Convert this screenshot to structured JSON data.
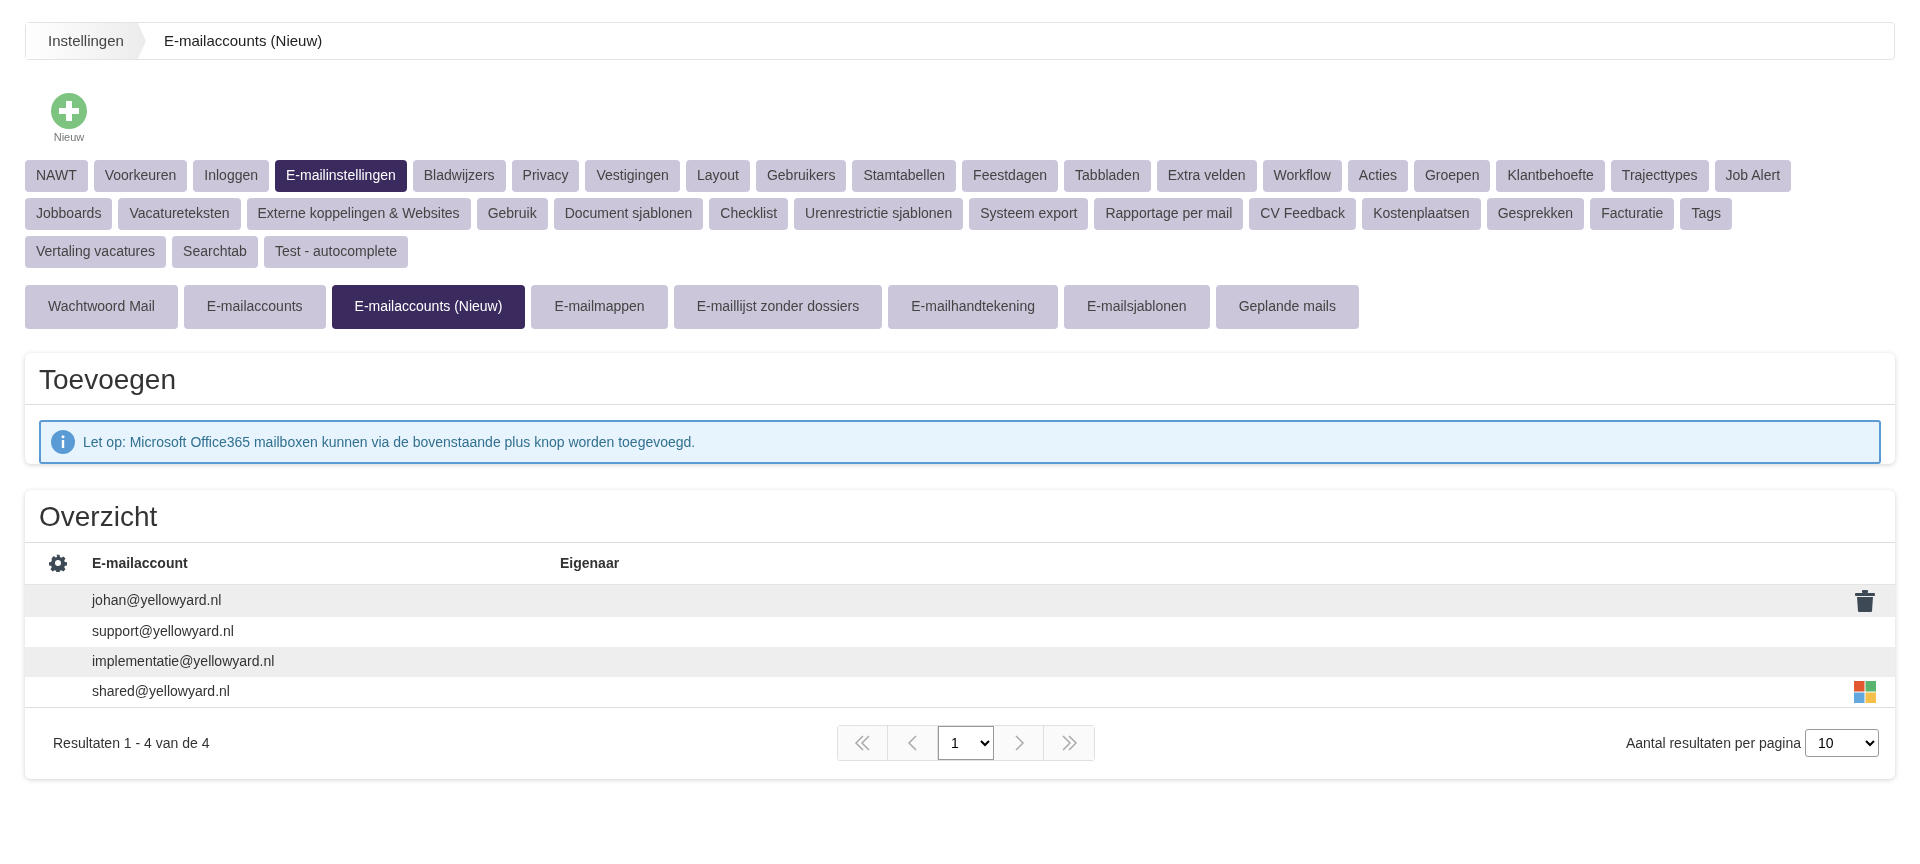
{
  "breadcrumb": [
    {
      "label": "Instellingen"
    },
    {
      "label": "E-mailaccounts (Nieuw)"
    }
  ],
  "new_button": {
    "label": "Nieuw"
  },
  "tab_rows": [
    [
      {
        "label": "NAWT",
        "selected": false
      },
      {
        "label": "Voorkeuren",
        "selected": false
      },
      {
        "label": "Inloggen",
        "selected": false
      },
      {
        "label": "E-mailinstellingen",
        "selected": true
      },
      {
        "label": "Bladwijzers",
        "selected": false
      },
      {
        "label": "Privacy",
        "selected": false
      },
      {
        "label": "Vestigingen",
        "selected": false
      },
      {
        "label": "Layout",
        "selected": false
      },
      {
        "label": "Gebruikers",
        "selected": false
      },
      {
        "label": "Stamtabellen",
        "selected": false
      },
      {
        "label": "Feestdagen",
        "selected": false
      },
      {
        "label": "Tabbladen",
        "selected": false
      },
      {
        "label": "Extra velden",
        "selected": false
      },
      {
        "label": "Workflow",
        "selected": false
      },
      {
        "label": "Acties",
        "selected": false
      },
      {
        "label": "Groepen",
        "selected": false
      },
      {
        "label": "Klantbehoefte",
        "selected": false
      },
      {
        "label": "Trajecttypes",
        "selected": false
      },
      {
        "label": "Job Alert",
        "selected": false
      }
    ],
    [
      {
        "label": "Jobboards",
        "selected": false
      },
      {
        "label": "Vacatureteksten",
        "selected": false
      },
      {
        "label": "Externe koppelingen & Websites",
        "selected": false
      },
      {
        "label": "Gebruik",
        "selected": false
      },
      {
        "label": "Document sjablonen",
        "selected": false
      },
      {
        "label": "Checklist",
        "selected": false
      },
      {
        "label": "Urenrestrictie sjablonen",
        "selected": false
      },
      {
        "label": "Systeem export",
        "selected": false
      },
      {
        "label": "Rapportage per mail",
        "selected": false
      },
      {
        "label": "CV Feedback",
        "selected": false
      },
      {
        "label": "Kostenplaatsen",
        "selected": false
      },
      {
        "label": "Gesprekken",
        "selected": false
      },
      {
        "label": "Facturatie",
        "selected": false
      },
      {
        "label": "Tags",
        "selected": false
      }
    ],
    [
      {
        "label": "Vertaling vacatures",
        "selected": false
      },
      {
        "label": "Searchtab",
        "selected": false
      },
      {
        "label": "Test - autocomplete",
        "selected": false
      }
    ]
  ],
  "subtabs": [
    {
      "label": "Wachtwoord Mail",
      "selected": false
    },
    {
      "label": "E-mailaccounts",
      "selected": false
    },
    {
      "label": "E-mailaccounts (Nieuw)",
      "selected": true
    },
    {
      "label": "E-mailmappen",
      "selected": false
    },
    {
      "label": "E-maillijst zonder dossiers",
      "selected": false
    },
    {
      "label": "E-mailhandtekening",
      "selected": false
    },
    {
      "label": "E-mailsjablonen",
      "selected": false
    },
    {
      "label": "Geplande mails",
      "selected": false
    }
  ],
  "add_panel": {
    "title": "Toevoegen",
    "info": "Let op: Microsoft Office365 mailboxen kunnen via de bovenstaande plus knop worden toegevoegd."
  },
  "overview": {
    "title": "Overzicht",
    "columns": [
      "E-mailaccount",
      "Eigenaar"
    ],
    "rows": [
      {
        "email": "johan@yellowyard.nl",
        "kind": "deletable"
      },
      {
        "email": "support@yellowyard.nl",
        "kind": "plain"
      },
      {
        "email": "implementatie@yellowyard.nl",
        "kind": "plain"
      },
      {
        "email": "shared@yellowyard.nl",
        "kind": "office365"
      }
    ],
    "results": "Resultaten 1 - 4 van de 4",
    "page": "1",
    "per_page_label": "Aantal resultaten per pagina",
    "per_page": "10"
  }
}
